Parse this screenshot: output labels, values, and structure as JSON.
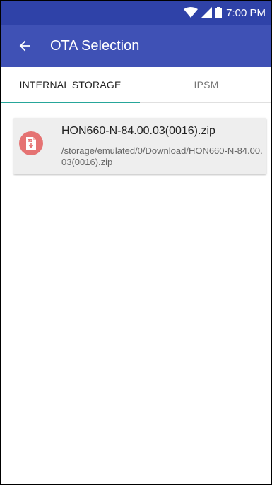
{
  "status_bar": {
    "time": "7:00 PM",
    "icons": [
      "wifi-icon",
      "signal-icon",
      "battery-icon"
    ]
  },
  "app_bar": {
    "back_icon": "arrow-left-icon",
    "title": "OTA Selection"
  },
  "tabs": [
    {
      "label": "INTERNAL STORAGE",
      "selected": true
    },
    {
      "label": "IPSM",
      "selected": false
    }
  ],
  "files": [
    {
      "icon": "zip-file-icon",
      "name": "HON660-N-84.00.03(0016).zip",
      "path": "/storage/emulated/0/Download/HON660-N-84.00.03(0016).zip"
    }
  ],
  "colors": {
    "app_bar": "#3f51b5",
    "status_bar": "#2f42a8",
    "tab_indicator": "#26a69a",
    "file_icon_bg": "#e57373"
  }
}
